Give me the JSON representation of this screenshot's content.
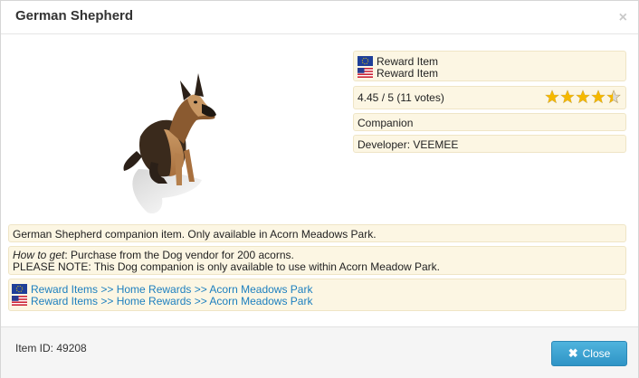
{
  "dialog": {
    "title": "German Shepherd",
    "close_icon": "close-icon"
  },
  "info": {
    "type_lines": [
      {
        "flag": "eu-flag-icon",
        "label": "Reward Item"
      },
      {
        "flag": "us-flag-icon",
        "label": "Reward Item"
      }
    ],
    "rating_text": "4.45 / 5 (11 votes)",
    "rating_value": 4.45,
    "rating_max": 5,
    "category": "Companion",
    "developer": "Developer: VEEMEE"
  },
  "description": "German Shepherd companion item. Only available in Acorn Meadows Park.",
  "how_to_get": {
    "label": "How to get",
    "text": ": Purchase from the Dog vendor for 200 acorns.",
    "note": "PLEASE NOTE: This Dog companion is only available to use within Acorn Meadow Park."
  },
  "breadcrumbs": [
    {
      "flag": "eu-flag-icon",
      "text": "Reward Items >> Home Rewards >> Acorn Meadows Park"
    },
    {
      "flag": "us-flag-icon",
      "text": "Reward Items >> Home Rewards >> Acorn Meadows Park"
    }
  ],
  "footer": {
    "item_id": "Item ID: 49208",
    "close_label": "Close"
  },
  "colors": {
    "box_bg": "#fcf6e3",
    "link": "#1c7fbf",
    "button": "#2f94c6",
    "star": "#f5b800"
  }
}
